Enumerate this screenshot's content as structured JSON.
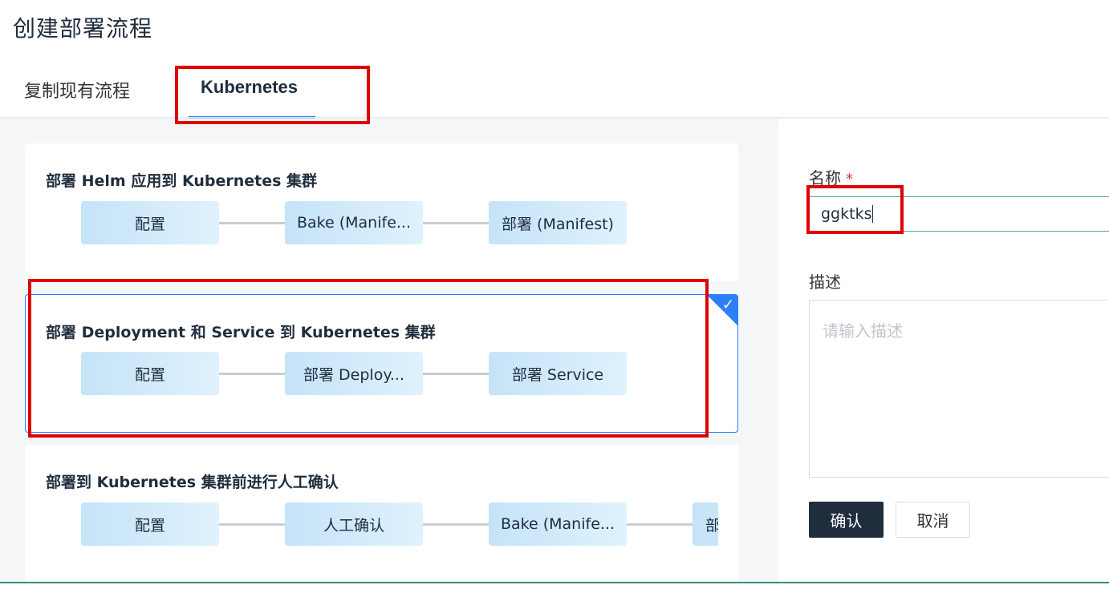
{
  "page": {
    "title": "创建部署流程"
  },
  "tabs": [
    {
      "label": "复制现有流程"
    },
    {
      "label": "Kubernetes"
    }
  ],
  "templates": [
    {
      "title": "部署 Helm 应用到 Kubernetes 集群",
      "steps": [
        "配置",
        "Bake (Manife...",
        "部署 (Manifest)"
      ]
    },
    {
      "title": "部署 Deployment 和 Service 到 Kubernetes 集群",
      "steps": [
        "配置",
        "部署 Deploy...",
        "部署 Service"
      ]
    },
    {
      "title": "部署到 Kubernetes 集群前进行人工确认",
      "steps": [
        "配置",
        "人工确认",
        "Bake (Manife...",
        "部"
      ]
    }
  ],
  "form": {
    "name_label": "名称",
    "required_mark": "*",
    "name_value": "ggktks",
    "desc_label": "描述",
    "desc_placeholder": "请输入描述",
    "confirm_label": "确认",
    "cancel_label": "取消"
  },
  "colors": {
    "accent": "#2d7ff9",
    "highlight_red": "#e00000",
    "primary_button": "#1f2d3d"
  }
}
